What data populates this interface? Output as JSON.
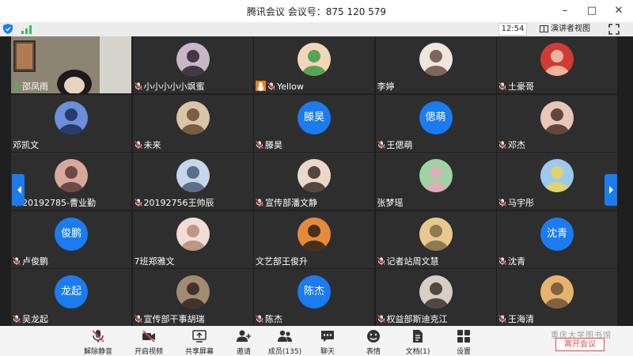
{
  "window": {
    "title": "腾讯会议 会议号：875 120 579",
    "controls": [
      "–",
      "□",
      "✕"
    ]
  },
  "infobar": {
    "time": "12:54",
    "speaker_view_label": "演讲者视图"
  },
  "colors": {
    "accent": "#1b7bf0",
    "tile_bg": "#2e2e2e",
    "active_speaker": "#3fbb5a",
    "leave": "#e04848",
    "host_badge": "#f07f1b"
  },
  "participants": [
    {
      "name": "邵凤雨",
      "mic": "on",
      "avatar": "video",
      "active": true
    },
    {
      "name": "小小小小小飒蜜",
      "mic": "muted",
      "avatar": "img1"
    },
    {
      "name": "Yellow",
      "mic": "muted",
      "avatar": "img2",
      "host": true
    },
    {
      "name": "李婷",
      "mic": "none",
      "avatar": "img3"
    },
    {
      "name": "土豪哥",
      "mic": "muted",
      "avatar": "img4"
    },
    {
      "name": "邓凯文",
      "mic": "none",
      "avatar": "img5"
    },
    {
      "name": "未来",
      "mic": "muted",
      "avatar": "img6"
    },
    {
      "name": "滕昊",
      "mic": "muted",
      "avatar": "text",
      "avatar_text": "滕昊"
    },
    {
      "name": "王偲萌",
      "mic": "muted",
      "avatar": "text",
      "avatar_text": "偲萌"
    },
    {
      "name": "邓杰",
      "mic": "muted",
      "avatar": "img7"
    },
    {
      "name": "20192785-曹业勤",
      "mic": "muted",
      "avatar": "img8"
    },
    {
      "name": "20192756王帅辰",
      "mic": "muted",
      "avatar": "img9"
    },
    {
      "name": "宣传部潘文静",
      "mic": "muted",
      "avatar": "img10"
    },
    {
      "name": "张梦瑶",
      "mic": "none",
      "avatar": "img11"
    },
    {
      "name": "马宇彤",
      "mic": "muted",
      "avatar": "img12"
    },
    {
      "name": "卢俊鹏",
      "mic": "muted",
      "avatar": "text",
      "avatar_text": "俊鹏"
    },
    {
      "name": "7班郑雅文",
      "mic": "none",
      "avatar": "img13"
    },
    {
      "name": "文艺部王俊升",
      "mic": "none",
      "avatar": "img14"
    },
    {
      "name": "记者站周文慧",
      "mic": "muted",
      "avatar": "img15"
    },
    {
      "name": "沈青",
      "mic": "muted",
      "avatar": "text",
      "avatar_text": "沈青"
    },
    {
      "name": "吴龙起",
      "mic": "muted",
      "avatar": "text",
      "avatar_text": "龙起"
    },
    {
      "name": "宣传部干事胡瑞",
      "mic": "muted",
      "avatar": "img16"
    },
    {
      "name": "陈杰",
      "mic": "muted",
      "avatar": "text",
      "avatar_text": "陈杰"
    },
    {
      "name": "权益部斯迪克江",
      "mic": "muted",
      "avatar": "img17"
    },
    {
      "name": "王海清",
      "mic": "muted",
      "avatar": "img18"
    }
  ],
  "avatar_palettes": {
    "img1": [
      "#c9b7c7",
      "#2a2230"
    ],
    "img2": [
      "#f3d6b8",
      "#3c9a43"
    ],
    "img3": [
      "#efe6de",
      "#6b4f46"
    ],
    "img4": [
      "#d03b33",
      "#f1c9b0"
    ],
    "img5": [
      "#6b8fd8",
      "#1d2b5a"
    ],
    "img6": [
      "#d9c5a7",
      "#6a4a2f"
    ],
    "img7": [
      "#e8c7b6",
      "#4e2f2a"
    ],
    "img8": [
      "#d8a89b",
      "#5b3a3a"
    ],
    "img9": [
      "#c7d6ea",
      "#4a5c7a"
    ],
    "img10": [
      "#ecd8c8",
      "#3c2d2a"
    ],
    "img11": [
      "#9fd3a4",
      "#e6a8c0"
    ],
    "img12": [
      "#9ec9ef",
      "#e9d35a"
    ],
    "img13": [
      "#f2dcd6",
      "#b58a76"
    ],
    "img14": [
      "#e38a3d",
      "#2d2016"
    ],
    "img15": [
      "#e7c98e",
      "#7f6a4a"
    ],
    "img16": [
      "#a38b73",
      "#2e2620"
    ],
    "img17": [
      "#d8cfc4",
      "#3a302a"
    ],
    "img18": [
      "#e6b36e",
      "#6e5238"
    ]
  },
  "toolbar": {
    "unmute": "解除静音",
    "start_video": "开启视频",
    "share_screen": "共享屏幕",
    "invite": "邀请",
    "members": "成员(135)",
    "chat": "聊天",
    "reactions": "表情",
    "documents": "文档(1)",
    "settings": "设置",
    "watermark": "重庆大学图书馆",
    "leave": "离开会议"
  }
}
